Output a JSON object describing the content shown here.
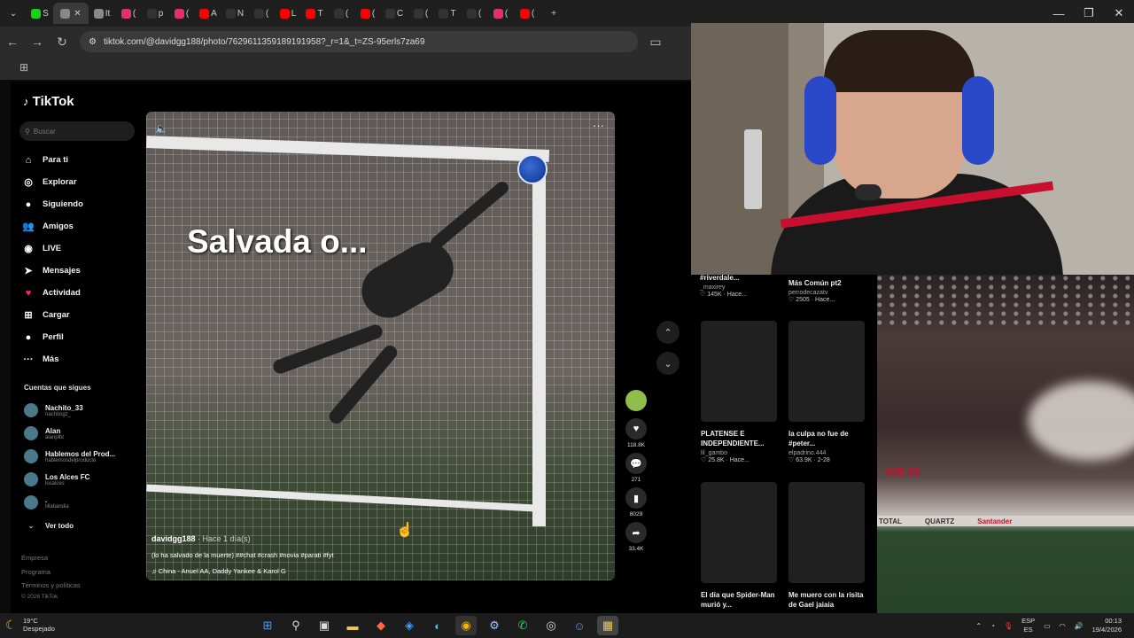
{
  "browser": {
    "tabs": [
      {
        "label": "S",
        "color": "#17d117"
      },
      {
        "label": "",
        "color": "#888888",
        "active": true
      },
      {
        "label": "It",
        "color": "#8a8a8a"
      },
      {
        "label": "(",
        "color": "#e1306c"
      },
      {
        "label": "p",
        "color": "#333333"
      },
      {
        "label": "(",
        "color": "#e1306c"
      },
      {
        "label": "A",
        "color": "#ff0000"
      },
      {
        "label": "N",
        "color": "#333333"
      },
      {
        "label": "(",
        "color": "#333333"
      },
      {
        "label": "L",
        "color": "#ff0000"
      },
      {
        "label": "T",
        "color": "#ff0000"
      },
      {
        "label": "(",
        "color": "#333333"
      },
      {
        "label": "(",
        "color": "#ff0000"
      },
      {
        "label": "C",
        "color": "#333333"
      },
      {
        "label": "(",
        "color": "#333333"
      },
      {
        "label": "T",
        "color": "#333333"
      },
      {
        "label": "(",
        "color": "#333333"
      },
      {
        "label": "(",
        "color": "#e1306c"
      },
      {
        "label": "(",
        "color": "#ff0000"
      }
    ],
    "new_tab": "+",
    "url": "tiktok.com/@davidgg188/photo/7629611359189191958?_r=1&_t=ZS-95erls7za69"
  },
  "tiktok": {
    "logo": "TikTok",
    "search_placeholder": "Buscar",
    "nav": [
      {
        "label": "Para ti",
        "icon": "home-icon",
        "glyph": "⌂"
      },
      {
        "label": "Explorar",
        "icon": "compass-icon",
        "glyph": "◎"
      },
      {
        "label": "Siguiendo",
        "icon": "following-avatar-icon",
        "glyph": "●"
      },
      {
        "label": "Amigos",
        "icon": "friends-icon",
        "glyph": "👥"
      },
      {
        "label": "LIVE",
        "icon": "live-icon",
        "glyph": "◉"
      },
      {
        "label": "Mensajes",
        "icon": "messages-icon",
        "glyph": "➤"
      },
      {
        "label": "Actividad",
        "icon": "activity-icon",
        "glyph": "♥"
      },
      {
        "label": "Cargar",
        "icon": "upload-icon",
        "glyph": "⊞"
      },
      {
        "label": "Perfil",
        "icon": "profile-icon",
        "glyph": "●"
      },
      {
        "label": "Más",
        "icon": "more-icon",
        "glyph": "···"
      }
    ],
    "following_title": "Cuentas que sigues",
    "following": [
      {
        "name": "Nachito_33",
        "handle": "nachitogz_"
      },
      {
        "name": "Alan",
        "handle": "alanplbt"
      },
      {
        "name": "Hablemos del Prod...",
        "handle": "hablemosdelproducto"
      },
      {
        "name": "Los Alces FC",
        "handle": "losalces"
      },
      {
        "name": ".",
        "handle": "lillabandia"
      }
    ],
    "see_all": "Ver todo",
    "footer": [
      "Empresa",
      "Programa",
      "Términos y políticas",
      "© 2026 TikTok"
    ]
  },
  "video": {
    "overlay_text": "Salvada o...",
    "username": "davidgg188",
    "time": "· Hace 1 día(s)",
    "caption": "(lo ha salvado de la muerte) ##chat #crash #novia #parati #fyt",
    "music": "♫  China - Anuel AA, Daddy Yankee & Karol G"
  },
  "actions": {
    "likes": "118.8K",
    "comments": "271",
    "saves": "8029",
    "shares": "33.4K"
  },
  "grid": [
    {
      "title": "#riverdale...",
      "user": "_maxirey",
      "meta": "♡ 145K · Hace..."
    },
    {
      "title": "Más Común pt2",
      "user": "perrodecazatv",
      "meta": "♡ 2505 · Hace..."
    },
    {
      "title": "PLATENSE E INDEPENDIENTE...",
      "user": "lil_gambo",
      "meta": "♡ 25.8K · Hace..."
    },
    {
      "title": "la culpa no fue de #peter...",
      "user": "elpadrino.444",
      "meta": "♡ 63.9K · 2-28"
    },
    {
      "title": "El día que Spider-Man murió y...",
      "user": "",
      "meta": ""
    },
    {
      "title": "Me muero con la risita de Gael jaiaia",
      "user": "",
      "meta": ""
    }
  ],
  "stadium": {
    "ad1": "TOTAL",
    "ad2": "QUARTZ",
    "ad3": "Santander",
    "banner": "KM 30"
  },
  "taskbar": {
    "temp": "19°C",
    "weather": "Despejado",
    "lang": "ESP",
    "lang2": "ES",
    "time": "00:13",
    "date": "19/4/2026"
  }
}
